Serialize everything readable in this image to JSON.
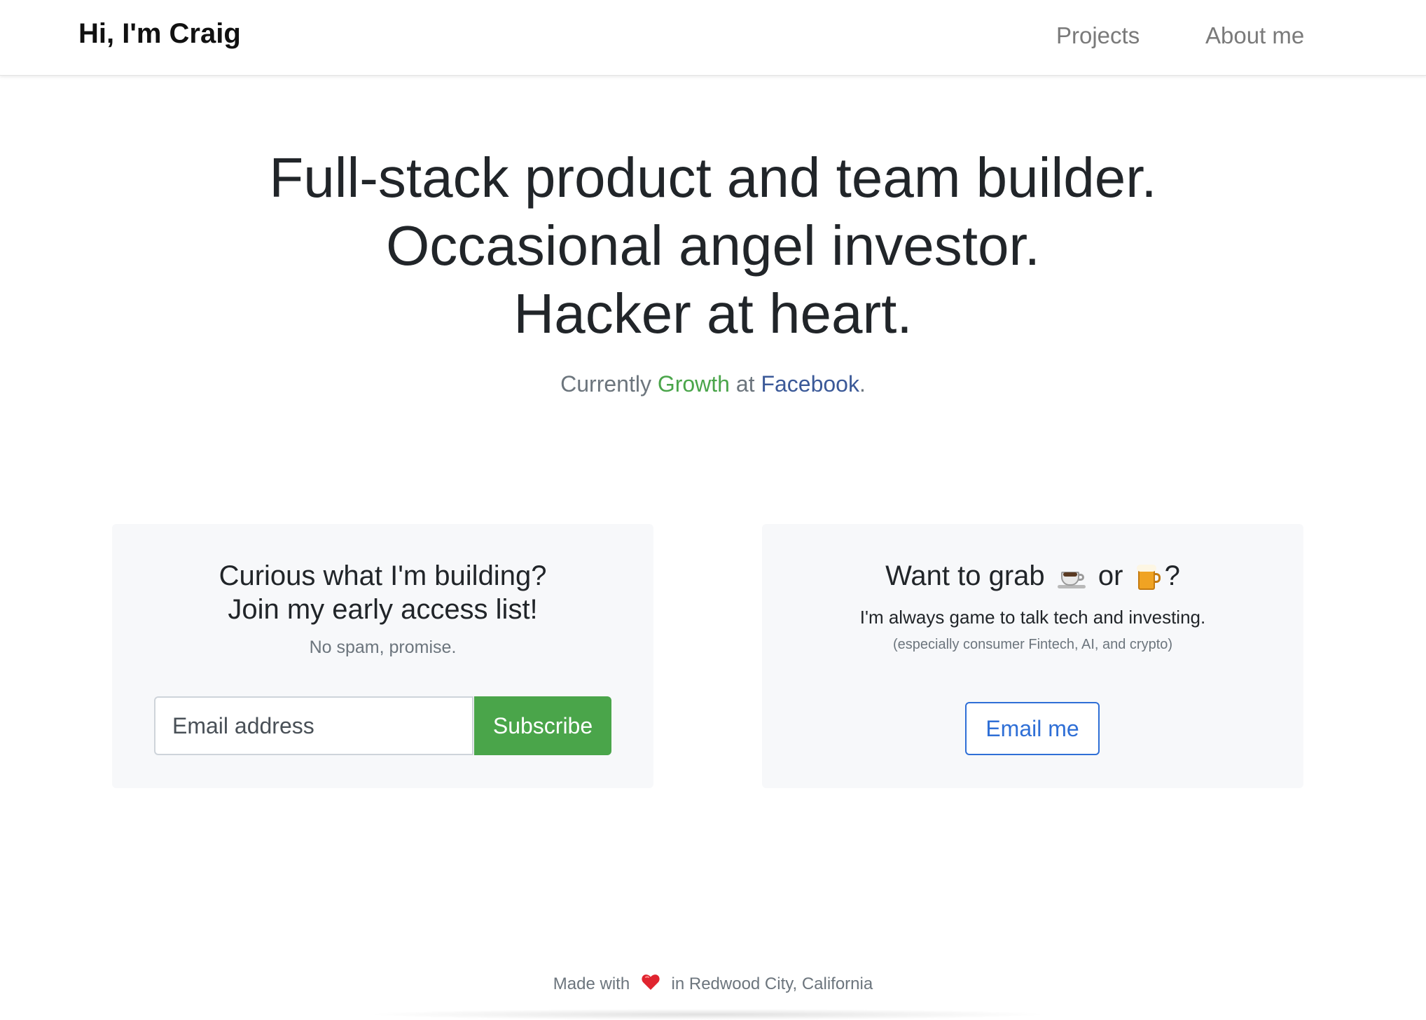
{
  "nav": {
    "brand": "Hi, I'm Craig",
    "links": [
      {
        "label": "Projects"
      },
      {
        "label": "About me"
      }
    ]
  },
  "hero": {
    "lines": [
      "Full-stack product and team builder.",
      "Occasional angel investor.",
      "Hacker at heart."
    ],
    "currently_prefix": "Currently",
    "role": "Growth",
    "at": "at",
    "company": "Facebook",
    "suffix": "."
  },
  "subscribe_card": {
    "title_line1": "Curious what I'm building?",
    "title_line2": "Join my early access list!",
    "note": "No spam, promise.",
    "email_placeholder": "Email address",
    "button_label": "Subscribe"
  },
  "contact_card": {
    "title_prefix": "Want to grab",
    "title_or": "or",
    "title_suffix": "?",
    "coffee_icon": "coffee-icon",
    "beer_icon": "beer-icon",
    "text": "I'm always game to talk tech and investing.",
    "small": "(especially consumer Fintech, AI, and crypto)",
    "button_label": "Email me"
  },
  "footer": {
    "prefix": "Made with",
    "heart_icon": "heart-icon",
    "suffix": "in Redwood City, California"
  },
  "colors": {
    "accent_green": "#4aa54a",
    "facebook_blue": "#3b5998",
    "link_blue": "#2f6fd6",
    "card_bg": "#f7f8fa"
  }
}
